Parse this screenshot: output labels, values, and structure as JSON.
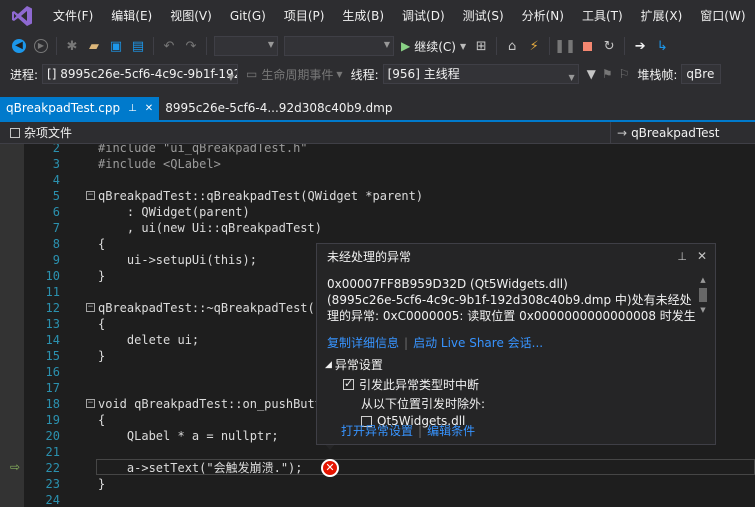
{
  "menu": {
    "items": [
      "文件(F)",
      "编辑(E)",
      "视图(V)",
      "Git(G)",
      "项目(P)",
      "生成(B)",
      "调试(D)",
      "测试(S)",
      "分析(N)",
      "工具(T)",
      "扩展(X)",
      "窗口(W)"
    ]
  },
  "toolbar": {
    "continue_label": "继续(C)"
  },
  "location": {
    "process_label": "进程:",
    "process_value": "[] 8995c26e-5cf6-4c9c-9b1f-192",
    "lifecycle_label": "生命周期事件",
    "thread_label": "线程:",
    "thread_value": "[956] 主线程",
    "stackframe_label": "堆栈帧:",
    "stackframe_value": "qBre"
  },
  "tabs": [
    {
      "label": "qBreakpadTest.cpp",
      "pin": "⊥",
      "close": "✕"
    },
    {
      "label": "8995c26e-5cf6-4...92d308c40b9.dmp"
    }
  ],
  "nav": {
    "left_label": "杂项文件",
    "right_label": "qBreakpadTest"
  },
  "editor": {
    "lines": [
      {
        "n": "2",
        "text": "#include \"ui_qBreakpadTest.h\""
      },
      {
        "n": "3",
        "text": "#include <QLabel>"
      },
      {
        "n": "4",
        "text": ""
      },
      {
        "n": "5",
        "text": "qBreakpadTest::qBreakpadTest(QWidget *parent)"
      },
      {
        "n": "6",
        "text": "    : QWidget(parent)"
      },
      {
        "n": "7",
        "text": "    , ui(new Ui::qBreakpadTest)"
      },
      {
        "n": "8",
        "text": "{"
      },
      {
        "n": "9",
        "text": "    ui->setupUi(this);"
      },
      {
        "n": "10",
        "text": "}"
      },
      {
        "n": "11",
        "text": ""
      },
      {
        "n": "12",
        "text": "qBreakpadTest::~qBreakpadTest()"
      },
      {
        "n": "13",
        "text": "{"
      },
      {
        "n": "14",
        "text": "    delete ui;"
      },
      {
        "n": "15",
        "text": "}"
      },
      {
        "n": "16",
        "text": ""
      },
      {
        "n": "17",
        "text": ""
      },
      {
        "n": "18",
        "text": "void qBreakpadTest::on_pushButt"
      },
      {
        "n": "19",
        "text": "{"
      },
      {
        "n": "20",
        "text": "    QLabel * a = nullptr;"
      },
      {
        "n": "21",
        "text": ""
      },
      {
        "n": "22",
        "text": "    a->setText(\"会触发崩溃.\");"
      },
      {
        "n": "23",
        "text": "}"
      },
      {
        "n": "24",
        "text": ""
      }
    ]
  },
  "exception": {
    "title": "未经处理的异常",
    "pin_icon": "⊥",
    "close_icon": "✕",
    "message_line1": "0x00007FF8B959D32D (Qt5Widgets.dll)",
    "message_line2": "(8995c26e-5cf6-4c9c-9b1f-192d308c40b9.dmp 中)处有未经处",
    "message_line3": "理的异常: 0xC0000005: 读取位置 0x0000000000000008 时发生",
    "link_copy": "复制详细信息",
    "link_liveshare": "启动 Live Share 会话...",
    "settings_header": "异常设置",
    "break_on_type": "引发此异常类型时中断",
    "except_from": "从以下位置引发时除外:",
    "module": "Qt5Widgets.dll",
    "link_open_settings": "打开异常设置",
    "link_edit_conditions": "编辑条件"
  },
  "colors": {
    "accent": "#007acc",
    "error": "#e51400",
    "link": "#3794ff"
  }
}
